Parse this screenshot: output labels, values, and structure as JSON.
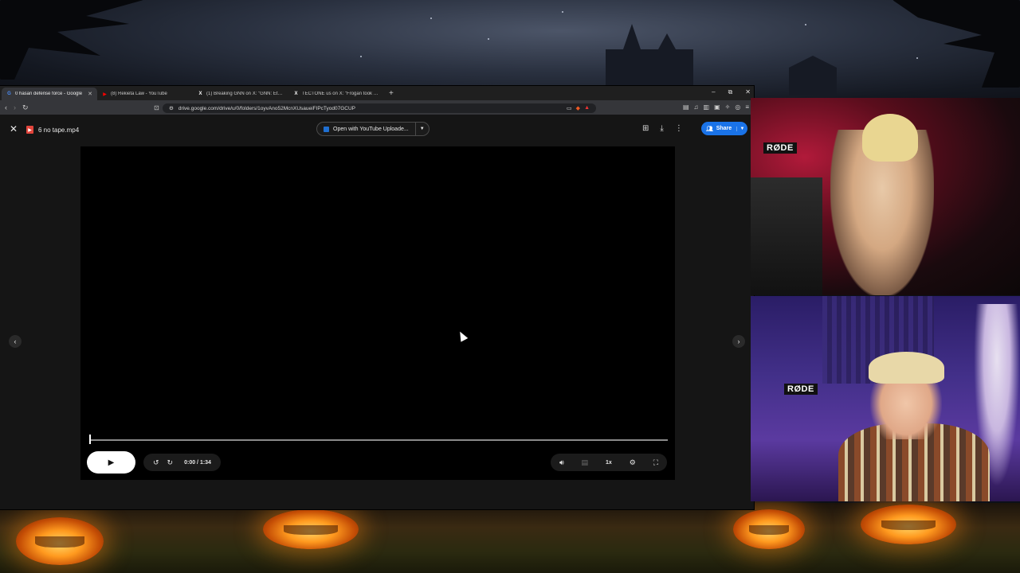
{
  "browser": {
    "tabs": [
      {
        "title": "0 hasan defense force - Google",
        "favicon": "G",
        "favicon_color": "#4a8cf7",
        "active": true,
        "close": "✕"
      },
      {
        "title": "(8) Rekieta Law - YouTube",
        "favicon": "▶",
        "favicon_color": "#ff0000",
        "active": false
      },
      {
        "title": "(1) Breaking GNN on X: \"GNN: Ethan",
        "favicon": "X",
        "favicon_color": "#ffffff",
        "active": false
      },
      {
        "title": "TECTONE us on X: \"Frogan took a bre",
        "favicon": "X",
        "favicon_color": "#ffffff",
        "active": false
      }
    ],
    "new_tab_label": "+",
    "window_controls": {
      "minimize": "–",
      "maximize": "⧉",
      "close": "✕"
    },
    "url": "drive.google.com/drive/u/0/folders/1oyvAno52McnXUsaueiFIPcTyod07GCUP"
  },
  "viewer": {
    "file_name": "6 no tape.mp4",
    "open_with_label": "Open with YouTube Uploade...",
    "share_label": "Share",
    "accent_color": "#1a73e8"
  },
  "player": {
    "time": "0:00 / 1:34",
    "progress": 0.0,
    "speed": "1x"
  },
  "cams": {
    "brand": "RØDE"
  }
}
